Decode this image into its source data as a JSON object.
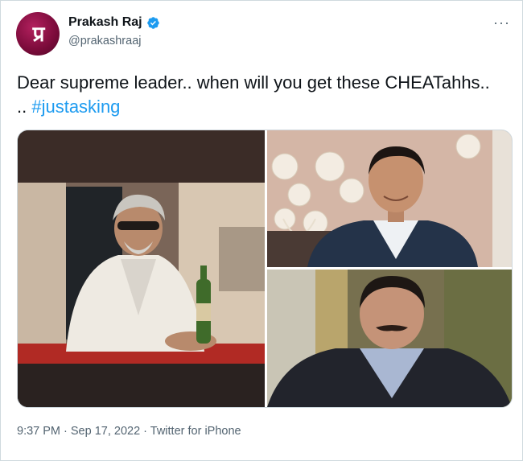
{
  "tweet": {
    "display_name": "Prakash Raj",
    "handle": "@prakashraaj",
    "text_before": "Dear supreme leader.. when will you get these CHEATahhs.. .. ",
    "hashtag": "#justasking",
    "timestamp": "9:37 PM · Sep 17, 2022 · Twitter for iPhone",
    "more_icon": "more-horizontal-icon",
    "verified_icon": "verified-badge-icon"
  },
  "colors": {
    "link": "#1d9bf0",
    "secondary_text": "#536471",
    "verified": "#1d9bf0",
    "avatar_bg": "#8a0c40"
  }
}
